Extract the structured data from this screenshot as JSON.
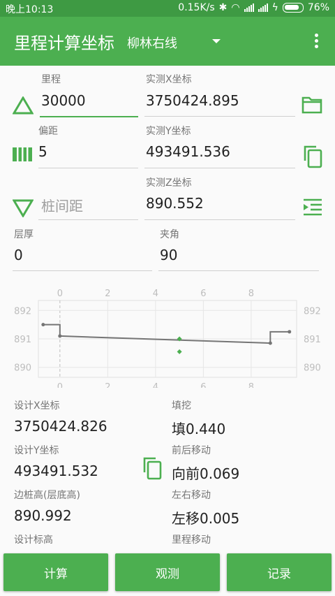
{
  "status_bar": {
    "time": "晚上10:13",
    "net_speed": "0.15K/s",
    "battery": "76%"
  },
  "app_bar": {
    "title": "里程计算坐标",
    "route": "柳林右线"
  },
  "form": {
    "mileage": {
      "label": "里程",
      "value": "30000"
    },
    "offset": {
      "label": "偏距",
      "value": "5"
    },
    "pile_spacing": {
      "placeholder": "桩间距"
    },
    "measured_x": {
      "label": "实测X坐标",
      "value": "3750424.895"
    },
    "measured_y": {
      "label": "实测Y坐标",
      "value": "493491.536"
    },
    "measured_z": {
      "label": "实测Z坐标",
      "value": "890.552"
    },
    "layer_thickness": {
      "label": "层厚",
      "value": "0"
    },
    "angle": {
      "label": "夹角",
      "value": "90"
    }
  },
  "chart_data": {
    "type": "line",
    "x_ticks": [
      "0",
      "2",
      "4",
      "6",
      "8"
    ],
    "y_ticks": [
      "892",
      "891",
      "890"
    ],
    "xlim": [
      -0.9,
      9.9
    ],
    "ylim": [
      889.65,
      892.35
    ],
    "series": [
      {
        "values": [
          [
            -0.7,
            891.5
          ],
          [
            0,
            891.5
          ],
          [
            0,
            891.1
          ],
          [
            8.8,
            890.85
          ],
          [
            8.8,
            891.25
          ],
          [
            9.6,
            891.25
          ]
        ]
      }
    ],
    "points": [
      [
        5,
        891.0
      ],
      [
        5,
        890.55
      ]
    ]
  },
  "results": {
    "design_x": {
      "label": "设计X坐标",
      "value": "3750424.826"
    },
    "design_y": {
      "label": "设计Y坐标",
      "value": "493491.532"
    },
    "edge_height": {
      "label": "边桩高(层底高)",
      "value": "890.992"
    },
    "design_elev": {
      "label": "设计标高"
    },
    "fill_cut": {
      "label": "填挖",
      "value": "填0.440"
    },
    "fb_move": {
      "label": "前后移动",
      "value": "向前0.069"
    },
    "lr_move": {
      "label": "左右移动",
      "value": "左移0.005"
    },
    "mileage_move": {
      "label": "里程移动"
    }
  },
  "buttons": {
    "calc": "计算",
    "observe": "观测",
    "record": "记录"
  },
  "colors": {
    "primary": "#4caf50",
    "status_bar": "#3e9a43"
  }
}
